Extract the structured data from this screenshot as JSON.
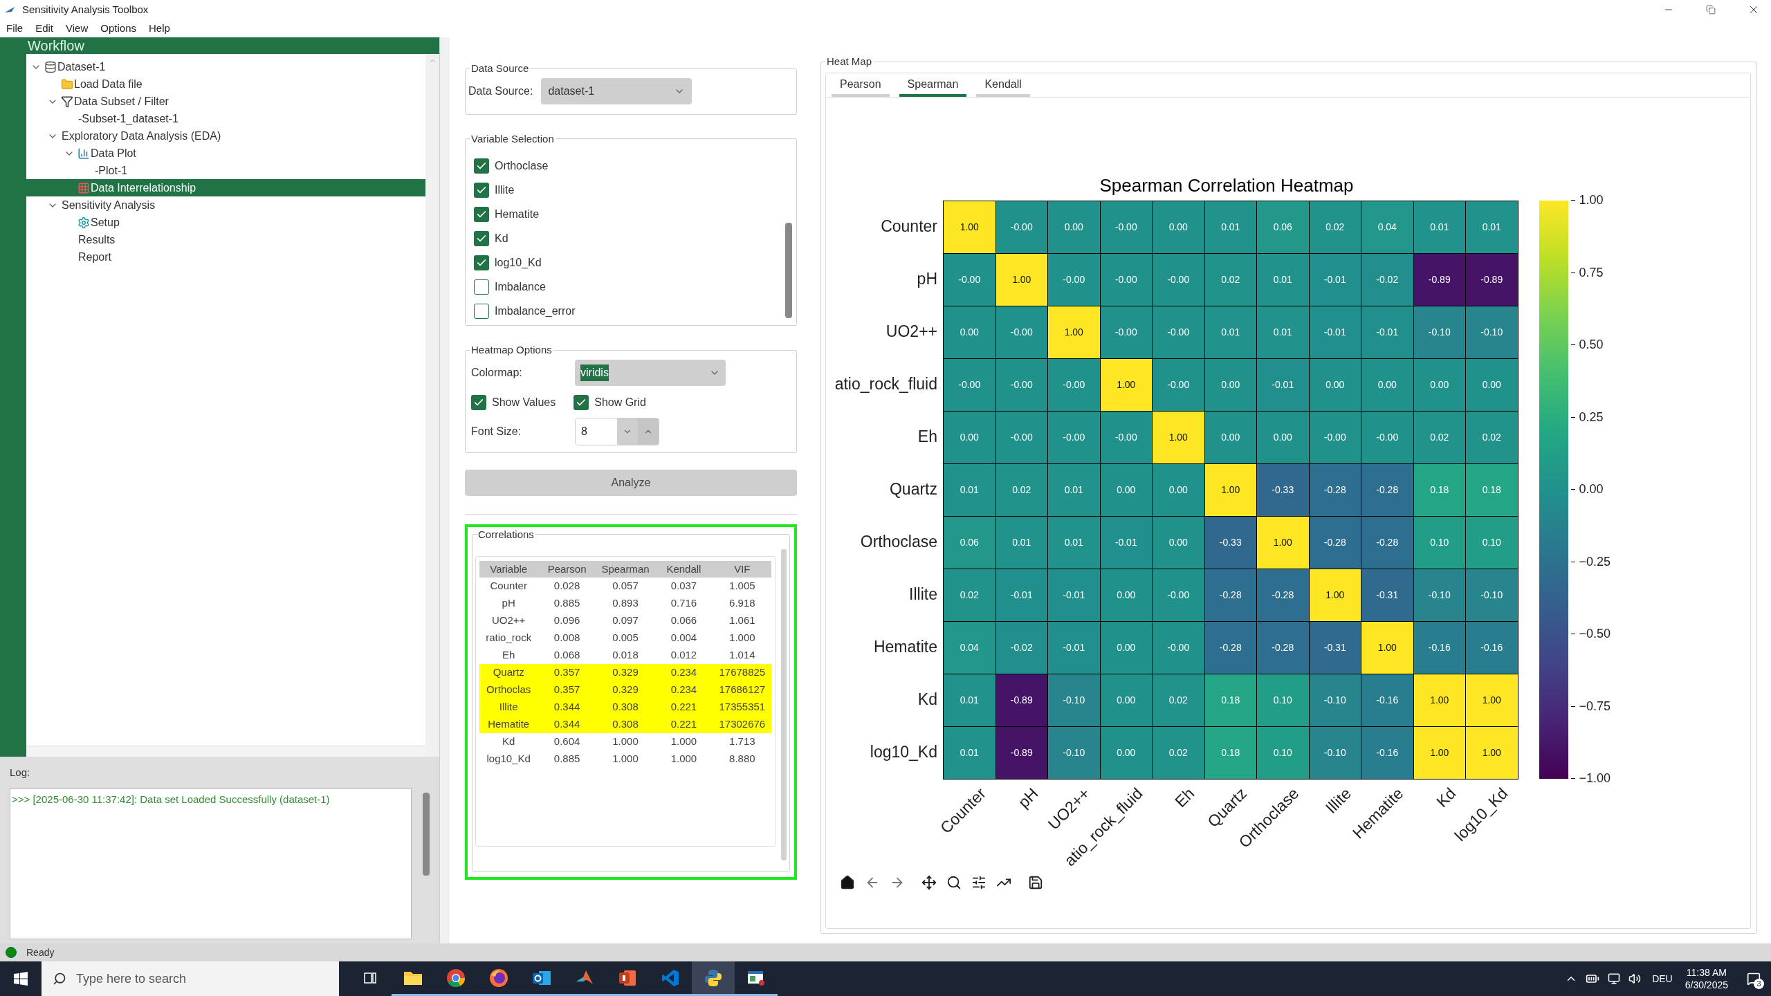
{
  "window": {
    "title": "Sensitivity Analysis Toolbox"
  },
  "menu": [
    "File",
    "Edit",
    "View",
    "Options",
    "Help"
  ],
  "workflow": {
    "title": "Workflow",
    "tree": [
      {
        "label": "Dataset-1",
        "kind": "dataset",
        "expanded": true,
        "selected": false,
        "children": [
          {
            "label": "Load Data file",
            "kind": "file",
            "selected": false
          },
          {
            "label": "Data Subset / Filter",
            "kind": "filter",
            "expanded": true,
            "selected": false,
            "children": [
              {
                "label": "-Subset-1_dataset-1",
                "kind": "plain",
                "selected": false
              }
            ]
          },
          {
            "label": "Exploratory Data Analysis (EDA)",
            "kind": "plain",
            "expanded": true,
            "selected": false,
            "children": [
              {
                "label": "Data Plot",
                "kind": "plot",
                "expanded": true,
                "selected": false,
                "children": [
                  {
                    "label": "-Plot-1",
                    "kind": "plain",
                    "selected": false
                  }
                ]
              },
              {
                "label": "Data Interrelationship",
                "kind": "matrix",
                "selected": true
              }
            ]
          },
          {
            "label": "Sensitivity Analysis",
            "kind": "plain",
            "expanded": true,
            "selected": false,
            "children": [
              {
                "label": "Setup",
                "kind": "setup",
                "selected": false
              },
              {
                "label": "Results",
                "kind": "plain",
                "selected": false
              },
              {
                "label": "Report",
                "kind": "plain",
                "selected": false
              }
            ]
          }
        ]
      }
    ]
  },
  "log": {
    "label": "Log:",
    "lines": [
      ">>> [2025-06-30 11:37:42]: Data set Loaded Successfully (dataset-1)"
    ]
  },
  "data_source": {
    "title": "Data Source",
    "label": "Data Source:",
    "value": "dataset-1"
  },
  "variable_selection": {
    "title": "Variable Selection",
    "items": [
      {
        "label": "Orthoclase",
        "checked": true
      },
      {
        "label": "Illite",
        "checked": true
      },
      {
        "label": "Hematite",
        "checked": true
      },
      {
        "label": "Kd",
        "checked": true
      },
      {
        "label": "log10_Kd",
        "checked": true
      },
      {
        "label": "Imbalance",
        "checked": false
      },
      {
        "label": "Imbalance_error",
        "checked": false
      }
    ]
  },
  "heatmap_options": {
    "title": "Heatmap Options",
    "colormap_label": "Colormap:",
    "colormap": "viridis",
    "show_values": {
      "label": "Show Values",
      "checked": true
    },
    "show_grid": {
      "label": "Show Grid",
      "checked": true
    },
    "font_size_label": "Font Size:",
    "font_size": "8"
  },
  "analyze_button": "Analyze",
  "correlations": {
    "title": "Correlations",
    "focused": true,
    "columns": [
      "Variable",
      "Pearson",
      "Spearman",
      "Kendall",
      "VIF"
    ],
    "rows": [
      {
        "cells": [
          "Counter",
          "0.028",
          "0.057",
          "0.037",
          "1.005"
        ],
        "highlighted": false
      },
      {
        "cells": [
          "pH",
          "0.885",
          "0.893",
          "0.716",
          "6.918"
        ],
        "highlighted": false
      },
      {
        "cells": [
          "UO2++",
          "0.096",
          "0.097",
          "0.066",
          "1.061"
        ],
        "highlighted": false
      },
      {
        "cells": [
          "ratio_rock",
          "0.008",
          "0.005",
          "0.004",
          "1.000"
        ],
        "highlighted": false
      },
      {
        "cells": [
          "Eh",
          "0.068",
          "0.018",
          "0.012",
          "1.014"
        ],
        "highlighted": false
      },
      {
        "cells": [
          "Quartz",
          "0.357",
          "0.329",
          "0.234",
          "17678825"
        ],
        "highlighted": true
      },
      {
        "cells": [
          "Orthoclas",
          "0.357",
          "0.329",
          "0.234",
          "17686127"
        ],
        "highlighted": true
      },
      {
        "cells": [
          "Illite",
          "0.344",
          "0.308",
          "0.221",
          "17355351"
        ],
        "highlighted": true
      },
      {
        "cells": [
          "Hematite",
          "0.344",
          "0.308",
          "0.221",
          "17302676"
        ],
        "highlighted": true
      },
      {
        "cells": [
          "Kd",
          "0.604",
          "1.000",
          "1.000",
          "1.713"
        ],
        "highlighted": false
      },
      {
        "cells": [
          "log10_Kd",
          "0.885",
          "1.000",
          "1.000",
          "8.880"
        ],
        "highlighted": false
      }
    ]
  },
  "heat_map": {
    "title": "Heat Map",
    "tabs": [
      {
        "label": "Pearson",
        "selected": false
      },
      {
        "label": "Spearman",
        "selected": true
      },
      {
        "label": "Kendall",
        "selected": false
      }
    ],
    "chart_title": "Spearman Correlation Heatmap",
    "row_labels": [
      "Counter",
      "pH",
      "UO2++",
      "atio_rock_fluid",
      "Eh",
      "Quartz",
      "Orthoclase",
      "Illite",
      "Hematite",
      "Kd",
      "log10_Kd"
    ],
    "column_labels": [
      "Counter",
      "pH",
      "UO2++",
      "atio_rock_fluid",
      "Eh",
      "Quartz",
      "Orthoclase",
      "Illite",
      "Hematite",
      "Kd",
      "log10_Kd"
    ],
    "values": [
      [
        "1.00",
        "-0.00",
        "0.00",
        "-0.00",
        "0.00",
        "0.01",
        "0.06",
        "0.02",
        "0.04",
        "0.01",
        "0.01"
      ],
      [
        "-0.00",
        "1.00",
        "-0.00",
        "-0.00",
        "-0.00",
        "0.02",
        "0.01",
        "-0.01",
        "-0.02",
        "-0.89",
        "-0.89"
      ],
      [
        "0.00",
        "-0.00",
        "1.00",
        "-0.00",
        "-0.00",
        "0.01",
        "0.01",
        "-0.01",
        "-0.01",
        "-0.10",
        "-0.10"
      ],
      [
        "-0.00",
        "-0.00",
        "-0.00",
        "1.00",
        "-0.00",
        "0.00",
        "-0.01",
        "0.00",
        "0.00",
        "0.00",
        "0.00"
      ],
      [
        "0.00",
        "-0.00",
        "-0.00",
        "-0.00",
        "1.00",
        "0.00",
        "0.00",
        "-0.00",
        "-0.00",
        "0.02",
        "0.02"
      ],
      [
        "0.01",
        "0.02",
        "0.01",
        "0.00",
        "0.00",
        "1.00",
        "-0.33",
        "-0.28",
        "-0.28",
        "0.18",
        "0.18"
      ],
      [
        "0.06",
        "0.01",
        "0.01",
        "-0.01",
        "0.00",
        "-0.33",
        "1.00",
        "-0.28",
        "-0.28",
        "0.10",
        "0.10"
      ],
      [
        "0.02",
        "-0.01",
        "-0.01",
        "0.00",
        "-0.00",
        "-0.28",
        "-0.28",
        "1.00",
        "-0.31",
        "-0.10",
        "-0.10"
      ],
      [
        "0.04",
        "-0.02",
        "-0.01",
        "0.00",
        "-0.00",
        "-0.28",
        "-0.28",
        "-0.31",
        "1.00",
        "-0.16",
        "-0.16"
      ],
      [
        "0.01",
        "-0.89",
        "-0.10",
        "0.00",
        "0.02",
        "0.18",
        "0.10",
        "-0.10",
        "-0.16",
        "1.00",
        "1.00"
      ],
      [
        "0.01",
        "-0.89",
        "-0.10",
        "0.00",
        "0.02",
        "0.18",
        "0.10",
        "-0.10",
        "-0.16",
        "1.00",
        "1.00"
      ]
    ],
    "colorbar_ticks": [
      "1.00",
      "0.75",
      "0.50",
      "0.25",
      "0.00",
      "−0.25",
      "−0.50",
      "−0.75",
      "−1.00"
    ]
  },
  "status_bar": {
    "text": "Ready"
  },
  "taskbar": {
    "search_placeholder": "Type here to search",
    "apps": [
      {
        "selected": false
      },
      {
        "selected": false
      },
      {
        "selected": false
      },
      {
        "selected": false
      },
      {
        "selected": false
      },
      {
        "selected": false
      },
      {
        "selected": false
      },
      {
        "selected": false
      },
      {
        "selected": true
      },
      {
        "selected": false
      }
    ],
    "language": "DEU",
    "time": "11:38 AM",
    "date": "6/30/2025",
    "notifications": "3"
  }
}
